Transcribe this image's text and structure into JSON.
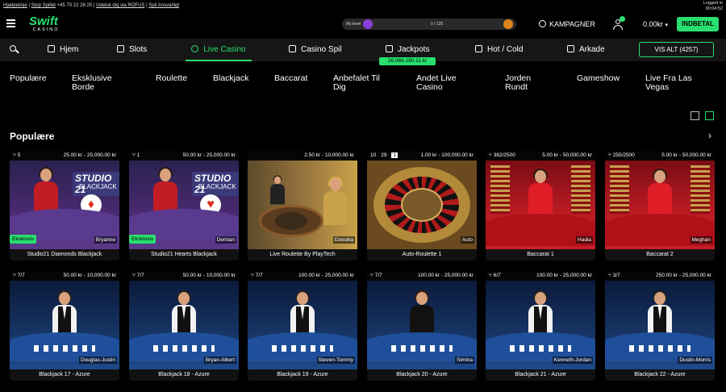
{
  "topbar": {
    "help": "Hjælpelinje",
    "stop": "Stop Spillet",
    "phone": "+45 70 22 28 25",
    "rofus": "Udeluk dig via ROFUS",
    "responsible": "Spil Ansvarligt",
    "logged_in": "Logged in",
    "time": "00:04:52"
  },
  "header": {
    "logo_word": "Swift",
    "logo_sub": "CASINO",
    "level_label": "My level",
    "level_progress": "0 / 125",
    "kampagner": "KAMPAGNER",
    "balance": "0.00kr",
    "deposit": "INDBETAL"
  },
  "nav": {
    "items": [
      {
        "label": "Hjem",
        "icon": "home-icon"
      },
      {
        "label": "Slots",
        "icon": "slots-icon"
      },
      {
        "label": "Live Casino",
        "icon": "person-icon",
        "active": true
      },
      {
        "label": "Casino Spil",
        "icon": "cards-icon"
      },
      {
        "label": "Jackpots",
        "icon": "jackpot-icon"
      },
      {
        "label": "Hot / Cold",
        "icon": "snowflake-icon"
      },
      {
        "label": "Arkade",
        "icon": "joystick-icon"
      }
    ],
    "view_all": "VIS ALT (4257)",
    "jackpot_amount": "26,066,180.11 kr"
  },
  "categories": [
    "Populære",
    "Eksklusive Borde",
    "Roulette",
    "Blackjack",
    "Baccarat",
    "Anbefalet Til Dig",
    "Andet Live Casino",
    "Jorden Rundt",
    "Gameshow",
    "Live Fra Las Vegas"
  ],
  "section": {
    "title": "Populære"
  },
  "games": [
    {
      "seats": "5",
      "limits": "25.00 kr - 25,000.00 kr",
      "dealer": "Bryanne",
      "title": "Studio21 Diamonds Blackjack",
      "badge": "Eksklusiv",
      "theme": "studio",
      "suit": "diamond"
    },
    {
      "seats": "1",
      "limits": "50.00 kr - 25,000.00 kr",
      "dealer": "Demian",
      "title": "Studio21 Hearts Blackjack",
      "badge": "Eksklusiv",
      "theme": "studio",
      "suit": "heart"
    },
    {
      "seats": "",
      "limits": "2.50 kr - 10,000.00 kr",
      "dealer": "Dzesika",
      "title": "Live Roulette By PlayTech",
      "badge": "",
      "theme": "roulette"
    },
    {
      "seats": "",
      "limits": "1.00 kr - 100,000.00 kr",
      "dealer": "Auto",
      "title": "Auto-Roulette 1",
      "badge": "",
      "theme": "auto",
      "recent": [
        "10",
        "29",
        "1"
      ]
    },
    {
      "seats": "382/2500",
      "limits": "5.00 kr - 50,000.00 kr",
      "dealer": "Hadia",
      "title": "Baccarat 1",
      "badge": "",
      "theme": "baccarat"
    },
    {
      "seats": "255/2500",
      "limits": "5.00 kr - 50,000.00 kr",
      "dealer": "Meghan",
      "title": "Baccarat 2",
      "badge": "",
      "theme": "baccarat"
    },
    {
      "seats": "7/7",
      "limits": "50.00 kr - 10,000.00 kr",
      "dealer": "Douglas-Justin",
      "title": "Blackjack 17 - Azure",
      "badge": "",
      "theme": "azure"
    },
    {
      "seats": "7/7",
      "limits": "50.00 kr - 10,000.00 kr",
      "dealer": "Bryan-Albert",
      "title": "Blackjack 18 - Azure",
      "badge": "",
      "theme": "azure"
    },
    {
      "seats": "7/7",
      "limits": "100.00 kr - 25,000.00 kr",
      "dealer": "Steven-Tommy",
      "title": "Blackjack 19 - Azure",
      "badge": "",
      "theme": "azure"
    },
    {
      "seats": "7/7",
      "limits": "100.00 kr - 25,000.00 kr",
      "dealer": "Simina",
      "title": "Blackjack 20 - Azure",
      "badge": "",
      "theme": "azure-f"
    },
    {
      "seats": "6/7",
      "limits": "100.00 kr - 25,000.00 kr",
      "dealer": "Kenneth-Jordan",
      "title": "Blackjack 21 - Azure",
      "badge": "",
      "theme": "azure"
    },
    {
      "seats": "3/7",
      "limits": "250.00 kr - 25,000.00 kr",
      "dealer": "Dustin-Morris",
      "title": "Blackjack 22 - Azure",
      "badge": "",
      "theme": "azure"
    }
  ],
  "colors": {
    "accent": "#28e06e",
    "background": "#000000",
    "nav_bg": "#161616"
  }
}
